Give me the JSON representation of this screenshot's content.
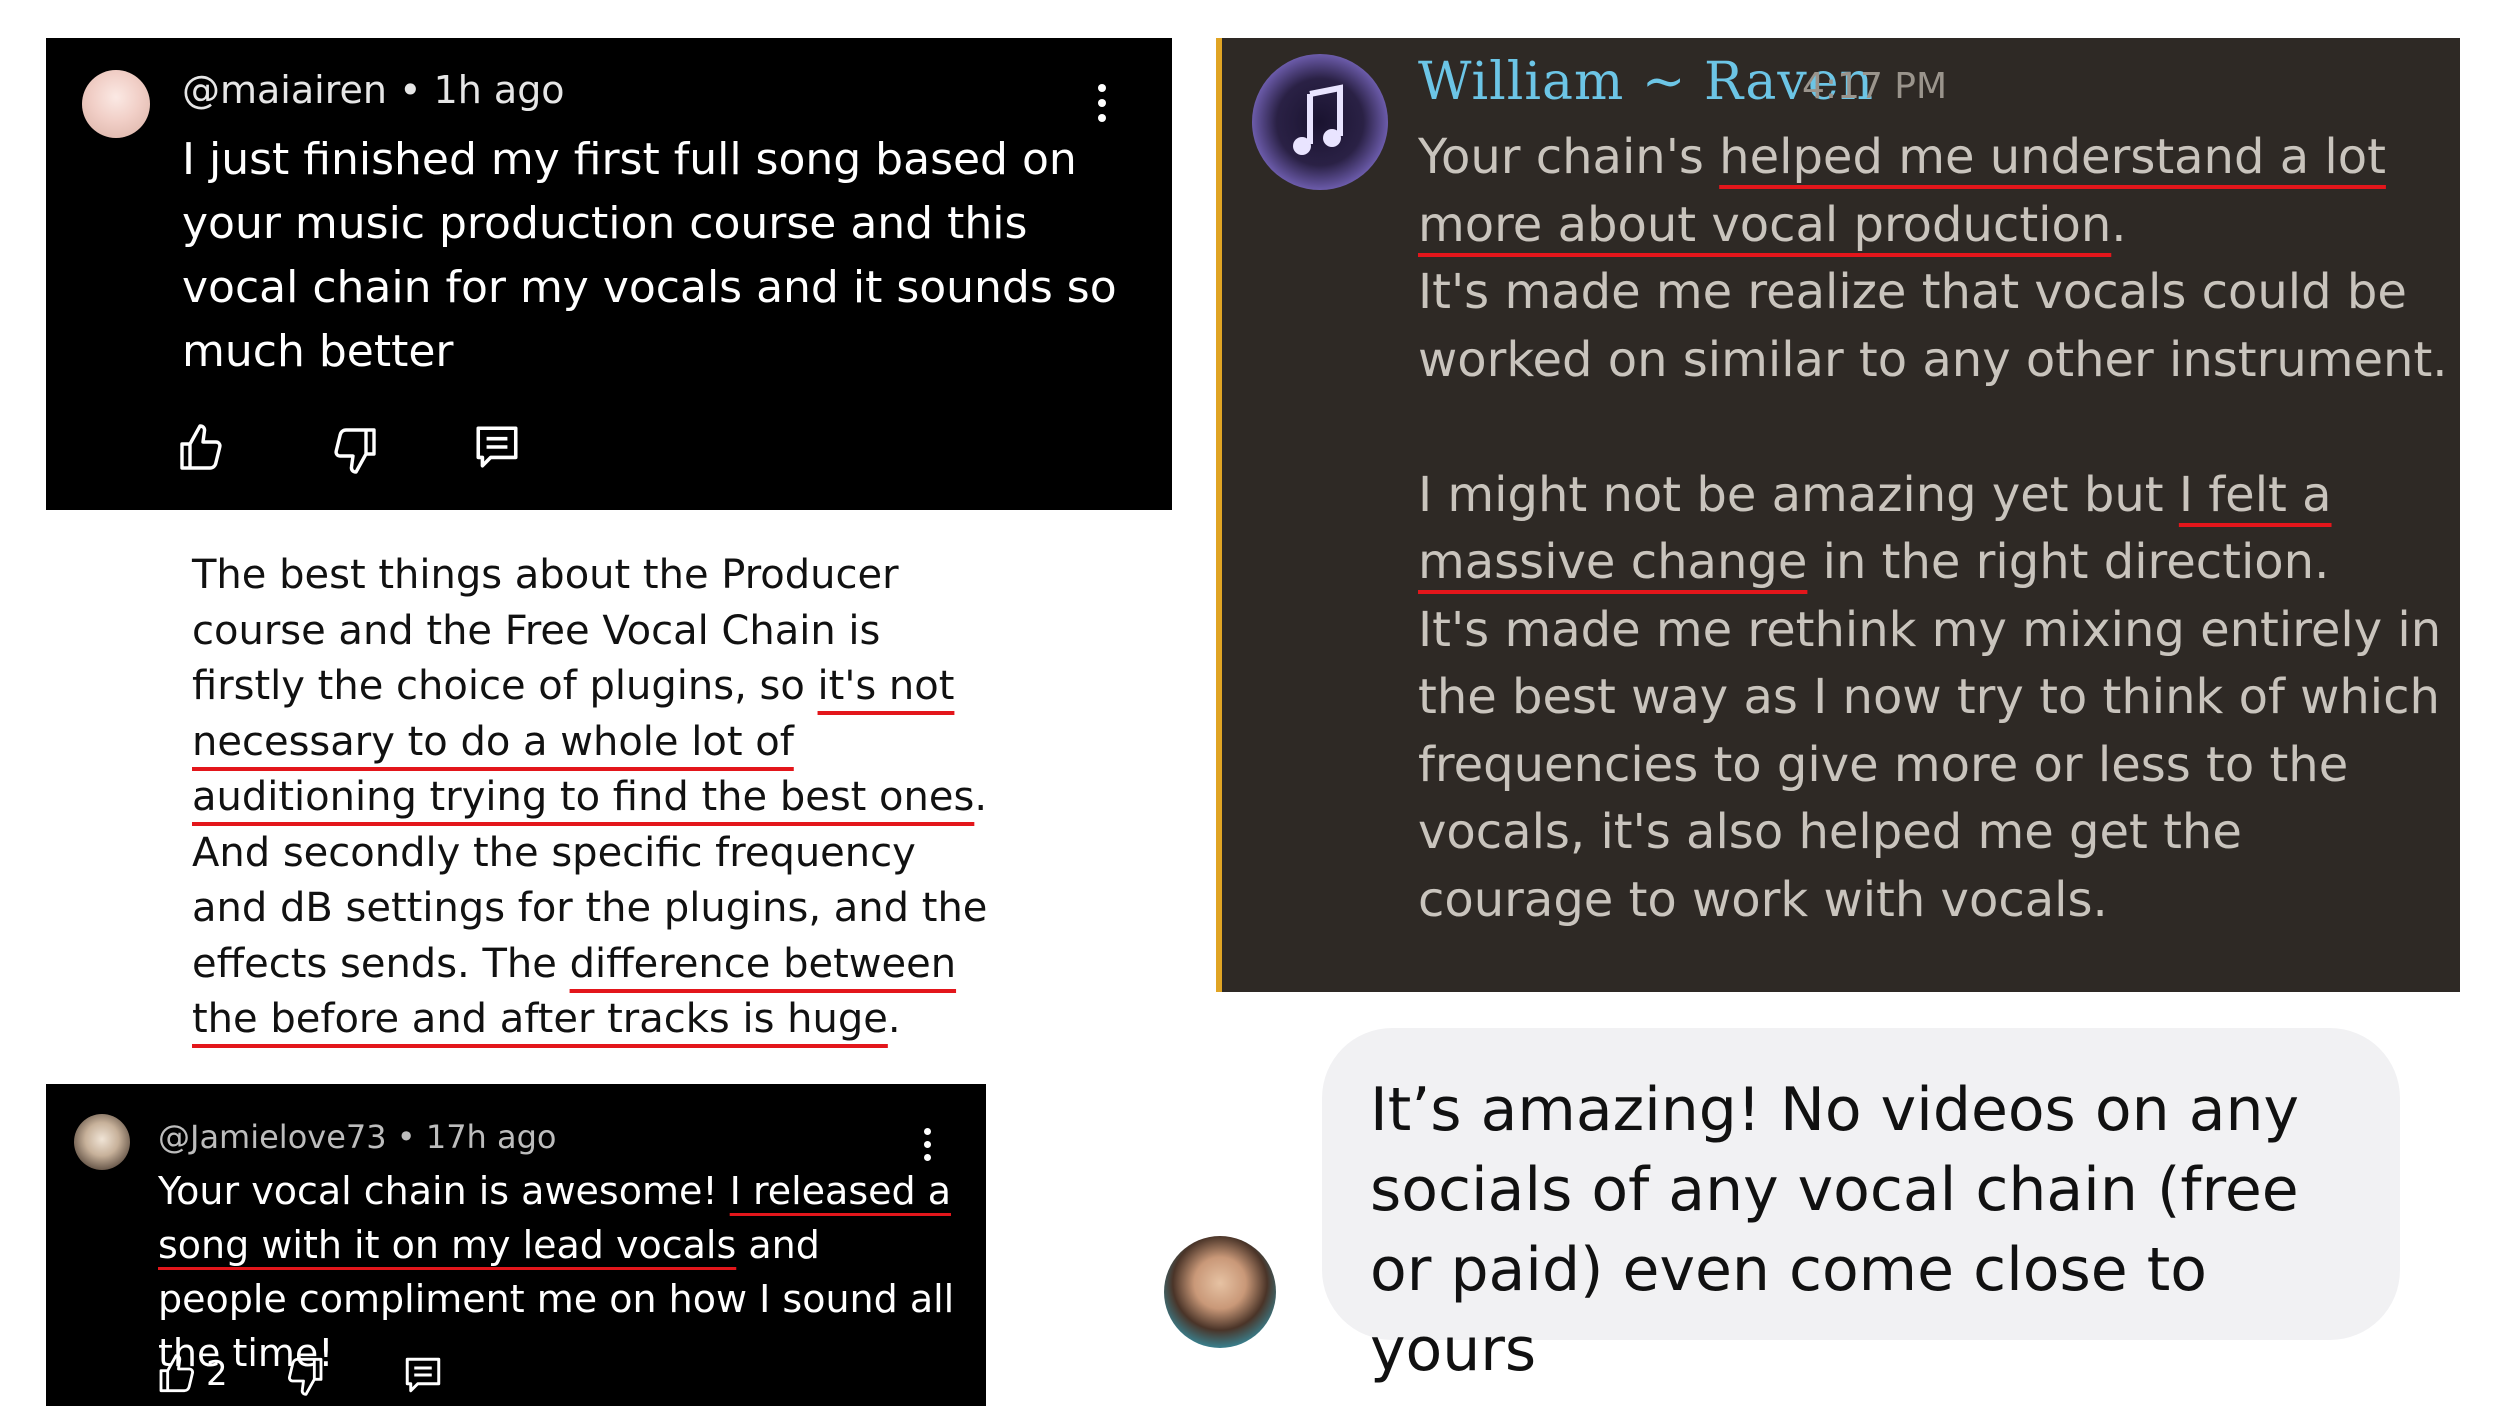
{
  "comment1": {
    "username": "@maiairen",
    "age": "1h ago",
    "text_a": "I just finished my first full song based on your music production course and this vocal chain for my vocals and it sounds so much better"
  },
  "course_review": {
    "p1": "The best things about the Producer course and the Free Vocal Chain is firstly the choice of plugins, so ",
    "u1": "it's not necessary to do a whole lot of auditioning trying to find the best ones",
    "p2": ". And secondly the specific frequency and dB settings for the plugins, and the effects sends. The ",
    "u2": "difference between the before and after tracks is huge",
    "p3": "."
  },
  "comment2": {
    "username": "@Jamielove73",
    "age": "17h ago",
    "p1": "Your vocal chain is awesome! ",
    "u1": "I released a song with it on my lead vocals",
    "p2": " and people compliment me on how I sound all the time!",
    "like_count": "2"
  },
  "discord": {
    "username": "William ~ Raven",
    "time": "4:17 PM",
    "p1": "Your chain's ",
    "u1": "helped me understand a lot more about vocal production",
    "p2": ".\nIt's made me realize that vocals could be worked on similar to any other instrument.\n\nI might not be amazing yet but ",
    "u2": "I felt a massive change",
    "p3": " in the right direction.\nIt's made me rethink my mixing entirely in the best way as I now try to think of which frequencies to give more or less to the vocals, it's also helped me get the courage to work with vocals."
  },
  "chat": {
    "text": "It’s amazing! No videos on any socials of any vocal chain (free or paid) even come close to yours"
  },
  "icons": {
    "like": "thumbs-up-icon",
    "dislike": "thumbs-down-icon",
    "reply": "comment-icon",
    "more": "more-vertical-icon"
  },
  "colors": {
    "underline": "#e3161b",
    "discord_bg": "#2e2925",
    "discord_accent": "#e0a424",
    "discord_name": "#6cc5e6"
  }
}
